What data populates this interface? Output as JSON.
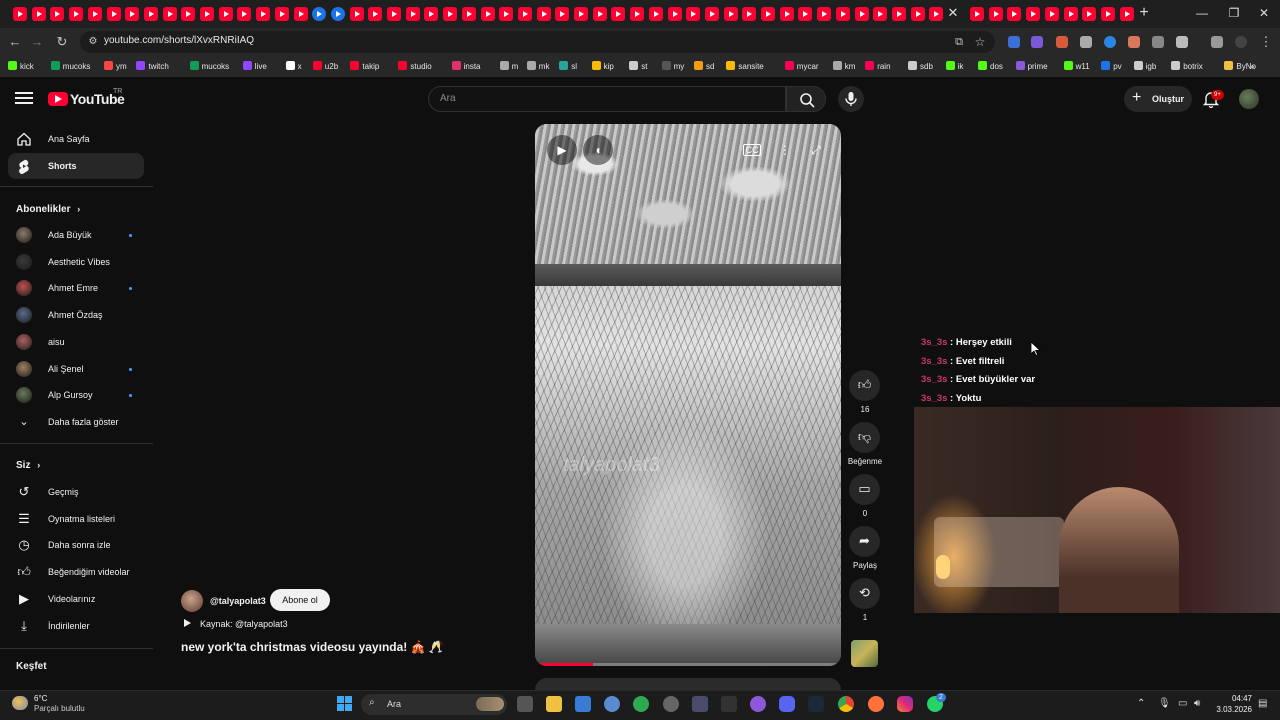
{
  "browser": {
    "url": "youtube.com/shorts/lXvxRNRiIAQ",
    "bookmarks": [
      "kick",
      "mucoks",
      "ym",
      "twitch",
      "mucoks",
      "live",
      "x",
      "u2b",
      "takip",
      "studio",
      "insta",
      "m",
      "mk",
      "sl",
      "kip",
      "st",
      "my",
      "sd",
      "sansite",
      "mycar",
      "km",
      "rain",
      "sdb",
      "ik",
      "dos",
      "prime",
      "w11",
      "pv",
      "igb",
      "botrix",
      "ByNo"
    ]
  },
  "header": {
    "logo_text": "YouTube",
    "country_code": "TR",
    "search_placeholder": "Ara",
    "create_label": "Oluştur",
    "notification_count": "9+"
  },
  "sidebar": {
    "nav": [
      {
        "label": "Ana Sayfa",
        "icon": "home-icon"
      },
      {
        "label": "Shorts",
        "icon": "shorts-icon",
        "active": true
      }
    ],
    "subscriptions_header": "Abonelikler",
    "subscriptions": [
      {
        "name": "Ada Büyük",
        "new": true
      },
      {
        "name": "Aesthetic Vibes",
        "new": false
      },
      {
        "name": "Ahmet Emre",
        "new": true
      },
      {
        "name": "Ahmet Özdaş",
        "new": false
      },
      {
        "name": "aisu",
        "new": false
      },
      {
        "name": "Ali Şenel",
        "new": true
      },
      {
        "name": "Alp Gursoy",
        "new": true
      }
    ],
    "show_more": "Daha fazla göster",
    "you_header": "Siz",
    "you_items": [
      {
        "label": "Geçmiş",
        "icon": "history-icon"
      },
      {
        "label": "Oynatma listeleri",
        "icon": "playlist-icon"
      },
      {
        "label": "Daha sonra izle",
        "icon": "clock-icon"
      },
      {
        "label": "Beğendiğim videolar",
        "icon": "like-icon"
      },
      {
        "label": "Videolarınız",
        "icon": "video-icon"
      },
      {
        "label": "İndirilenler",
        "icon": "download-icon"
      }
    ],
    "explore_header": "Keşfet"
  },
  "short": {
    "channel": "@talyapolat3",
    "subscribe_label": "Abone ol",
    "source_label": "Kaynak: @talyapolat3",
    "title": "new york'ta christmas videosu yayında! 🎪 🥂",
    "watermark": "talyapolat3",
    "progress": 0.19,
    "likes": "16",
    "dislike_label": "Beğenme",
    "comments": "0",
    "share_label": "Paylaş",
    "remix_count": "1"
  },
  "chat": [
    {
      "user": "3s_3s",
      "message": "Herşey etkili"
    },
    {
      "user": "3s_3s",
      "message": "Evet filtreli"
    },
    {
      "user": "3s_3s",
      "message": "Evet büyükler var"
    },
    {
      "user": "3s_3s",
      "message": "Yoktu"
    }
  ],
  "taskbar": {
    "temperature": "6°C",
    "weather": "Parçalı bulutlu",
    "search_label": "Ara",
    "time": "04:47",
    "date": "3.03.2026",
    "whatsapp_badge": "2"
  }
}
